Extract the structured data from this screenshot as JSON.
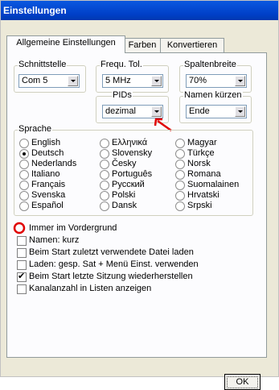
{
  "window": {
    "title": "Einstellungen"
  },
  "tabs": [
    "Allgemeine Einstellungen",
    "Farben",
    "Konvertieren"
  ],
  "groups": {
    "schnittstelle": {
      "label": "Schnittstelle",
      "value": "Com 5"
    },
    "frequ": {
      "label": "Frequ. Tol.",
      "value": "5 MHz"
    },
    "spaltenbreite": {
      "label": "Spaltenbreite",
      "value": "70%"
    },
    "pids": {
      "label": "PIDs",
      "value": "dezimal"
    },
    "namen_kuerzen": {
      "label": "Namen kürzen",
      "value": "Ende"
    }
  },
  "sprache": {
    "label": "Sprache",
    "col1": [
      "English",
      "Deutsch",
      "Nederlands",
      "Italiano",
      "Français",
      "Svenska",
      "Español"
    ],
    "col2": [
      "Ελληνικά",
      "Slovensky",
      "Česky",
      "Português",
      "Русский",
      "Polski",
      "Dansk"
    ],
    "col3": [
      "Magyar",
      "Türkçe",
      "Norsk",
      "Romana",
      "Suomalainen",
      "Hrvatski",
      "Srpski"
    ],
    "selected": "Deutsch"
  },
  "options": [
    {
      "label": "Immer im Vordergrund",
      "checked": false
    },
    {
      "label": "Namen: kurz",
      "checked": false
    },
    {
      "label": "Beim Start zuletzt verwendete Datei laden",
      "checked": false
    },
    {
      "label": "Laden: gesp. Sat + Menü Einst. verwenden",
      "checked": false
    },
    {
      "label": "Beim Start letzte Sitzung wiederherstellen",
      "checked": true
    },
    {
      "label": "Kanalanzahl in Listen anzeigen",
      "checked": false
    }
  ],
  "ok_label": "OK",
  "annotation_color": "#e00000"
}
